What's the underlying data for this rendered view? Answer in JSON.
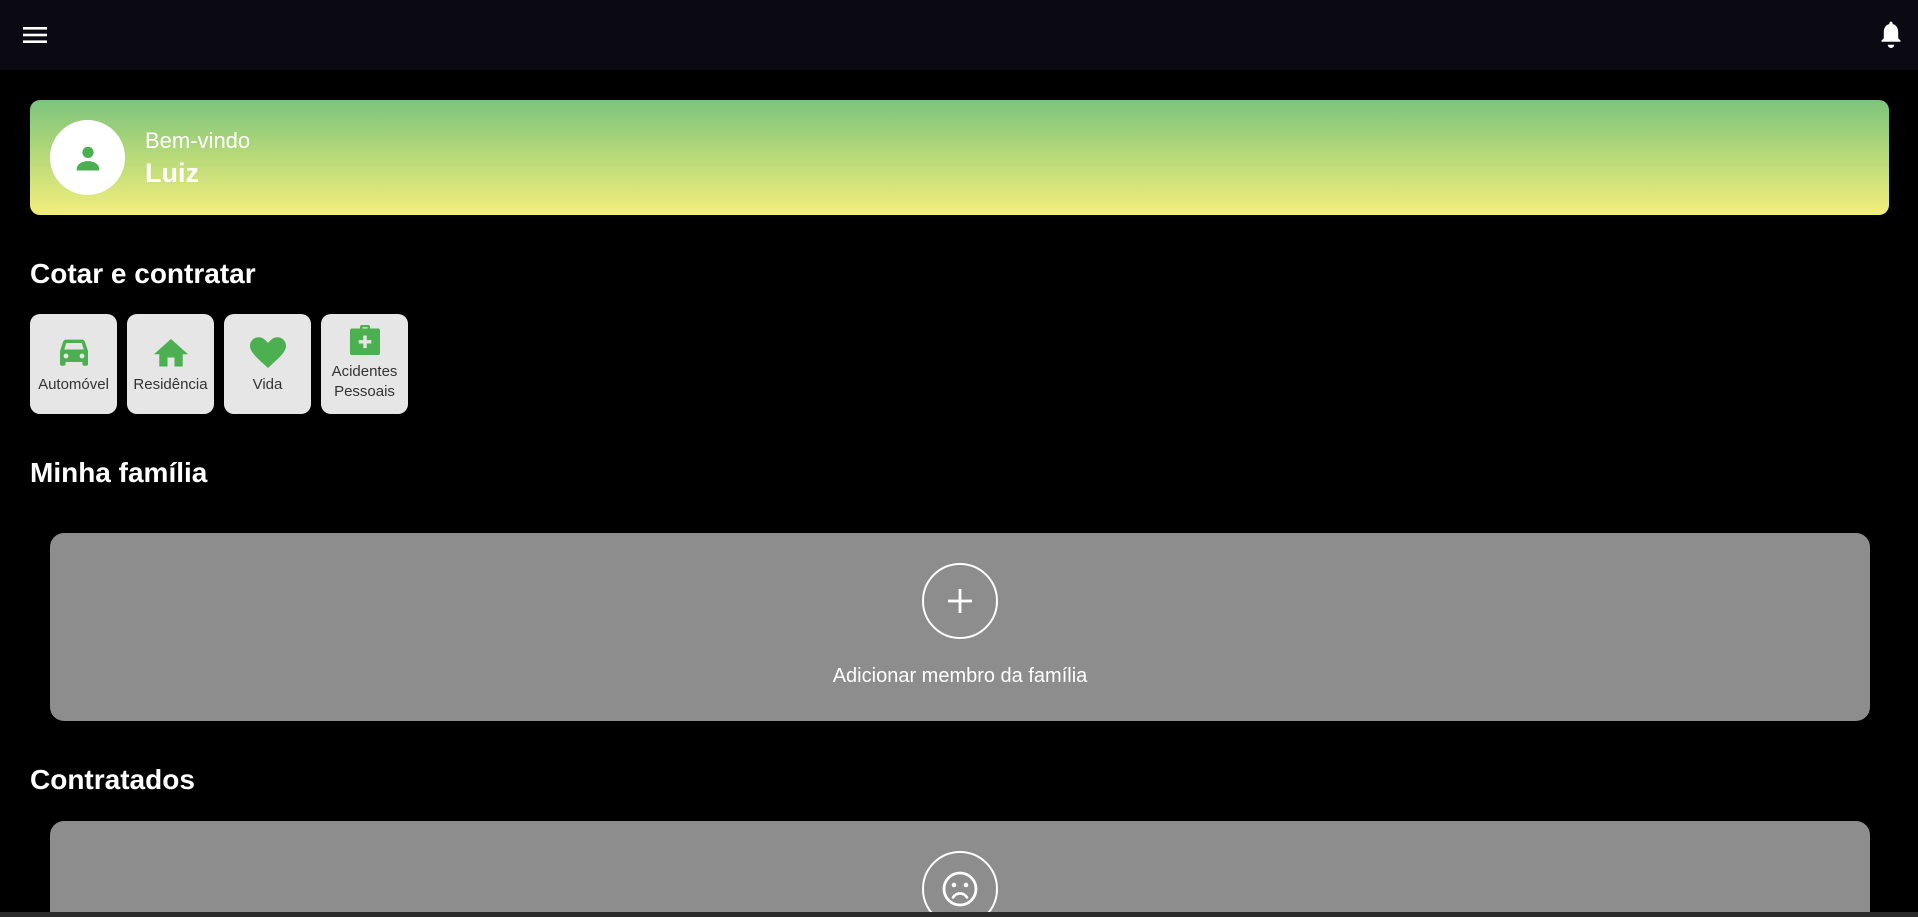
{
  "app_bar": {
    "menu_icon": "menu-icon",
    "bell_icon": "notification-bell-icon",
    "background": "#0b0a12"
  },
  "welcome": {
    "greeting": "Bem-vindo",
    "name": "Luiz",
    "avatar_icon": "person-icon",
    "gradient_top": "#7cc47d",
    "gradient_bottom": "#f3ee7c"
  },
  "quote_section": {
    "title": "Cotar e contratar",
    "items": [
      {
        "label": "Automóvel",
        "icon": "car-icon"
      },
      {
        "label": "Residência",
        "icon": "home-icon"
      },
      {
        "label": "Vida",
        "icon": "heart-icon"
      },
      {
        "label": "Acidentes\nPessoais",
        "icon": "medical-kit-icon"
      }
    ]
  },
  "family_section": {
    "title": "Minha família",
    "add_label": "Adicionar membro da família",
    "add_icon": "plus-icon"
  },
  "contracts_section": {
    "title": "Contratados",
    "empty_icon": "sad-face-icon"
  },
  "colors": {
    "accent_green": "#4caf50",
    "card_grey": "#8d8d8d",
    "tile_grey": "#e6e6e6"
  }
}
